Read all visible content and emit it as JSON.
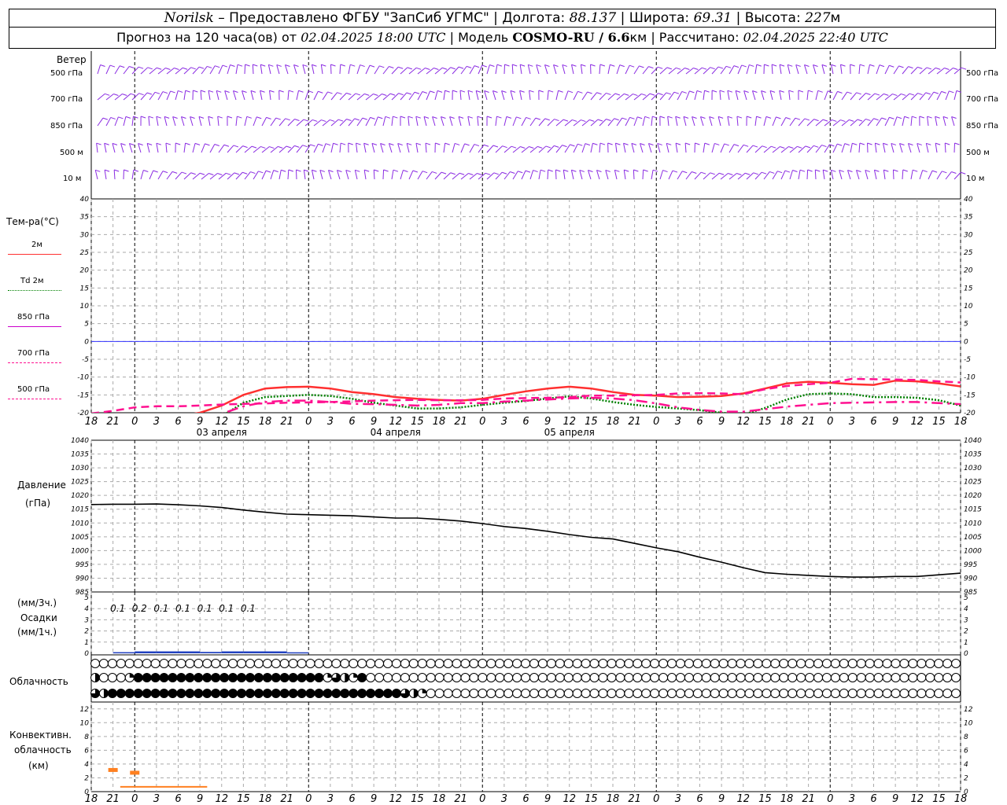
{
  "header": {
    "city": "Norilsk",
    "provider": "– Предоставлено ФГБУ \"ЗапСиб УГМС\" |",
    "lon_label": "Долгота:",
    "lon_value": "88.137",
    "lat_label": "| Широта:",
    "lat_value": "69.31",
    "alt_label": "| Высота:",
    "alt_value": "227",
    "alt_unit": "м",
    "forecast_prefix": "Прогноз на 120 часа(ов) от",
    "forecast_start": "02.04.2025 18:00 UTC",
    "model_label": "| Модель",
    "model_name": "COSMO-RU / 6.6",
    "model_unit": "км",
    "calc_label": "| Рассчитано:",
    "calc_time": "02.04.2025 22:40 UTC"
  },
  "wind_panel": {
    "title": "Ветер",
    "levels": [
      "500 гПа",
      "700 гПа",
      "850 гПа",
      "500 м",
      "10 м"
    ],
    "color": "#8a2be2"
  },
  "temp_panel": {
    "title": "Тем-ра(°C)",
    "legend": [
      {
        "label": "2м",
        "color": "#ff3030",
        "style": "solid"
      },
      {
        "label": "Td 2м",
        "color": "#008000",
        "style": "dotted"
      },
      {
        "label": "850 гПа",
        "color": "#cc00cc",
        "style": "solid"
      },
      {
        "label": "700 гПа",
        "color": "#ff1090",
        "style": "dashdot"
      },
      {
        "label": "500 гПа",
        "color": "#ff1090",
        "style": "dashed"
      }
    ],
    "yticks": [
      40,
      35,
      30,
      25,
      20,
      15,
      10,
      5,
      0,
      -5,
      -10,
      -15,
      -20
    ]
  },
  "pressure_panel": {
    "title": "Давление",
    "unit": "(гПа)",
    "yticks": [
      1040,
      1035,
      1030,
      1025,
      1020,
      1015,
      1010,
      1005,
      1000,
      995,
      990,
      985
    ]
  },
  "precip_panel": {
    "unit3": "(мм/3ч.)",
    "title": "Осадки",
    "unit1": "(мм/1ч.)",
    "yticks": [
      5,
      4,
      3,
      2,
      1,
      0
    ],
    "labels": [
      "0.1",
      "0.2",
      "0.1",
      "0.1",
      "0.1",
      "0.1",
      "0.1"
    ]
  },
  "cloud_panel": {
    "title": "Облачность"
  },
  "conv_panel": {
    "title1": "Конвективн.",
    "title2": "облачность",
    "unit": "(км)",
    "yticks": [
      12,
      10,
      8,
      6,
      4,
      2,
      0
    ]
  },
  "x_axis": {
    "hour_labels": [
      "18",
      "21",
      "0",
      "3",
      "6",
      "9",
      "12",
      "15",
      "18",
      "21",
      "0",
      "3",
      "6",
      "9",
      "12",
      "15",
      "18",
      "21",
      "0",
      "3",
      "6",
      "9",
      "12",
      "15",
      "18",
      "21",
      "0"
    ],
    "dates": [
      "03 апреля",
      "04 апреля",
      "05 апреля"
    ]
  },
  "chart_data": {
    "type": "line",
    "x_unit": "hours from 02.04.2025 18:00 UTC",
    "temperature": {
      "ylim": [
        -20,
        40
      ],
      "series": [
        {
          "name": "2м",
          "x": [
            0,
            3,
            6,
            9,
            12,
            15,
            18,
            21,
            24,
            27,
            30,
            33,
            36,
            39,
            42,
            45,
            48,
            51,
            54,
            57,
            60,
            63,
            66,
            69,
            72,
            75,
            78,
            81,
            84,
            87,
            90,
            93,
            96,
            99,
            102,
            105,
            108,
            111,
            114,
            117,
            120
          ],
          "values": [
            -24,
            -24,
            -23,
            -22,
            -21,
            -20,
            -18,
            -15,
            -13.2,
            -12.8,
            -12.7,
            -13.2,
            -14.2,
            -14.8,
            -15.6,
            -16.1,
            -16.4,
            -16.6,
            -16.1,
            -15,
            -14,
            -13.2,
            -12.7,
            -13.2,
            -14.2,
            -15,
            -15.2,
            -15.6,
            -15.5,
            -15.3,
            -14.6,
            -13.2,
            -11.8,
            -11.3,
            -11.6,
            -12,
            -12.2,
            -11,
            -11.2,
            -11.8,
            -12.6
          ]
        },
        {
          "name": "Td 2м",
          "x": [
            0,
            3,
            6,
            9,
            12,
            15,
            18,
            21,
            24,
            27,
            30,
            33,
            36,
            39,
            42,
            45,
            48,
            51,
            54,
            57,
            60,
            63,
            66,
            69,
            72,
            75,
            78,
            81,
            84,
            87,
            90,
            93,
            96,
            99,
            102,
            105,
            108,
            111,
            114,
            117,
            120
          ],
          "values": [
            -26,
            -26,
            -25.5,
            -25,
            -24,
            -23,
            -21,
            -17.2,
            -15.6,
            -15.3,
            -15,
            -15.3,
            -16.1,
            -17.2,
            -18,
            -18.8,
            -18.8,
            -18.5,
            -17.8,
            -17.2,
            -16.7,
            -16,
            -15.4,
            -16,
            -17,
            -17.8,
            -18.4,
            -18.8,
            -19.3,
            -20,
            -20.5,
            -18.7,
            -16.3,
            -14.8,
            -14.6,
            -14.8,
            -15.6,
            -15.6,
            -15.8,
            -16.5,
            -18
          ]
        },
        {
          "name": "850 гПа",
          "x": [
            0,
            30,
            60,
            90,
            120
          ],
          "values": [
            -25,
            -25,
            -25,
            -25,
            -25
          ]
        },
        {
          "name": "700 гПа",
          "x": [
            0,
            3,
            6,
            9,
            12,
            15,
            18,
            21,
            24,
            27,
            30,
            33,
            36,
            39,
            42,
            45,
            48,
            51,
            54,
            57,
            60,
            63,
            66,
            69,
            72,
            75,
            78,
            81,
            84,
            87,
            90,
            93,
            96,
            99,
            102,
            105,
            108,
            111,
            114,
            117,
            120
          ],
          "values": [
            -22,
            -22,
            -22,
            -22,
            -21.5,
            -21,
            -20.3,
            -18.2,
            -17,
            -16.6,
            -16.6,
            -17,
            -17.5,
            -17.6,
            -17.8,
            -18,
            -17.8,
            -17.3,
            -17.3,
            -16.9,
            -16.6,
            -16.3,
            -16,
            -15.8,
            -16,
            -16.5,
            -17.4,
            -18.5,
            -19.2,
            -19.7,
            -19.7,
            -19,
            -18.3,
            -17.8,
            -17.3,
            -17.2,
            -17.1,
            -17,
            -17,
            -17.3,
            -17.6
          ]
        },
        {
          "name": "500 гПа",
          "x": [
            0,
            3,
            6,
            9,
            12,
            15,
            18,
            21,
            24,
            27,
            30,
            33,
            36,
            39,
            42,
            45,
            48,
            51,
            54,
            57,
            60,
            63,
            66,
            69,
            72,
            75,
            78,
            81,
            84,
            87,
            90,
            93,
            96,
            99,
            102,
            105,
            108,
            111,
            114,
            117,
            120
          ],
          "values": [
            -20.2,
            -19.5,
            -18.5,
            -18.2,
            -18.2,
            -18,
            -17.7,
            -17.5,
            -17.4,
            -17.2,
            -17.1,
            -17,
            -16.8,
            -16.6,
            -16.5,
            -16.4,
            -16.5,
            -16.5,
            -16.4,
            -16,
            -15.9,
            -15.8,
            -15.6,
            -15.2,
            -15.2,
            -15.1,
            -15,
            -14.6,
            -14.5,
            -14.6,
            -14.8,
            -13.4,
            -12.5,
            -12,
            -11.6,
            -10.5,
            -10.6,
            -10.7,
            -10.8,
            -11.2,
            -11.5
          ]
        }
      ]
    },
    "pressure": {
      "ylim": [
        985,
        1040
      ],
      "x": [
        0,
        3,
        6,
        9,
        12,
        15,
        18,
        21,
        24,
        27,
        30,
        33,
        36,
        39,
        42,
        45,
        48,
        51,
        54,
        57,
        60,
        63,
        66,
        69,
        72,
        75,
        78,
        81,
        84,
        87,
        90,
        93,
        96,
        99,
        102,
        105,
        108,
        111,
        114,
        117,
        120
      ],
      "values": [
        1016.7,
        1016.8,
        1016.8,
        1016.9,
        1016.6,
        1016.2,
        1015.6,
        1014.7,
        1013.9,
        1013.2,
        1013,
        1012.8,
        1012.6,
        1012.2,
        1011.8,
        1011.8,
        1011.3,
        1010.7,
        1009.8,
        1008.7,
        1008,
        1007,
        1005.8,
        1004.8,
        1004.2,
        1002.6,
        1001,
        999.6,
        997.6,
        995.8,
        993.8,
        992,
        991.4,
        991,
        990.6,
        990.4,
        990.4,
        990.6,
        990.6,
        991.2,
        991.8
      ]
    },
    "precipitation": {
      "ylim": [
        0,
        5
      ],
      "x": [
        6,
        9,
        12,
        15,
        18,
        21,
        24,
        27,
        30
      ],
      "values": [
        0.03,
        0.1,
        0.1,
        0.1,
        0.05,
        0.1,
        0.1,
        0.1,
        0.02
      ]
    },
    "cloudiness": {
      "rows": [
        "high",
        "middle",
        "low"
      ],
      "step_hours": 1,
      "high": "0000000000000000000000000000000000000000000000000000000000000000000000000000000000000000000000000000000000000000000000000",
      "middle": "20001444444444444444444444413214000000000000000000000000000000000000000000000000000000000000000000000000000000000000000",
      "low": "3244444444444444444444444444444444443210000000000000000000000000000000000000000000000000000000000000000000000000000000"
    },
    "convective": {
      "ylim": [
        0,
        13
      ],
      "bases": [
        {
          "x": [
            4,
            16
          ],
          "base": 0.7
        }
      ],
      "tops": [
        {
          "x": [
            3,
            3.3
          ],
          "value": 3.2
        },
        {
          "x": [
            6,
            6.3
          ],
          "value": 2.8
        }
      ]
    }
  }
}
